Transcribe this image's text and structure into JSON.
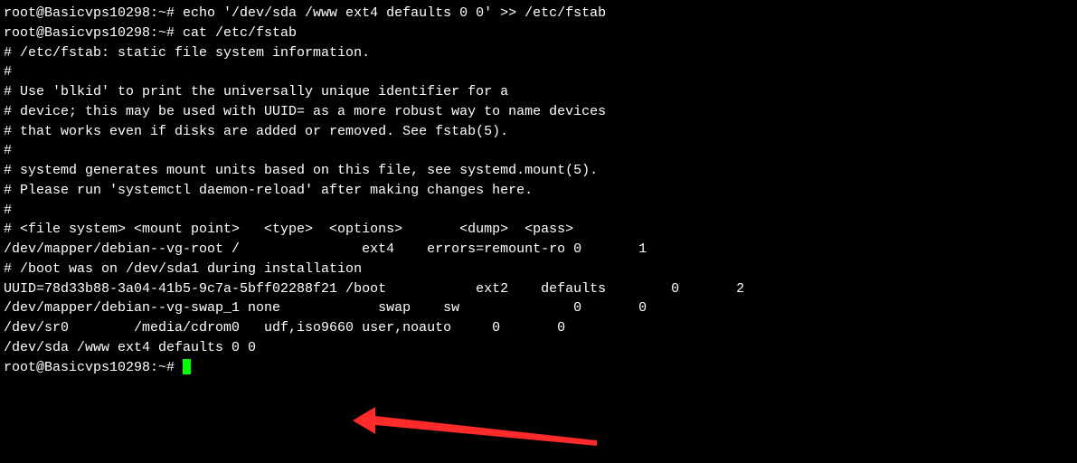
{
  "lines": {
    "l0": "root@Basicvps10298:~# echo '/dev/sda /www ext4 defaults 0 0' >> /etc/fstab",
    "l1": "root@Basicvps10298:~# cat /etc/fstab",
    "l2": "# /etc/fstab: static file system information.",
    "l3": "#",
    "l4": "# Use 'blkid' to print the universally unique identifier for a",
    "l5": "# device; this may be used with UUID= as a more robust way to name devices",
    "l6": "# that works even if disks are added or removed. See fstab(5).",
    "l7": "#",
    "l8": "# systemd generates mount units based on this file, see systemd.mount(5).",
    "l9": "# Please run 'systemctl daemon-reload' after making changes here.",
    "l10": "#",
    "l11": "# <file system> <mount point>   <type>  <options>       <dump>  <pass>",
    "l12": "/dev/mapper/debian--vg-root /               ext4    errors=remount-ro 0       1",
    "l13": "# /boot was on /dev/sda1 during installation",
    "l14": "UUID=78d33b88-3a04-41b5-9c7a-5bff02288f21 /boot           ext2    defaults        0       2",
    "l15": "/dev/mapper/debian--vg-swap_1 none            swap    sw              0       0",
    "l16": "/dev/sr0        /media/cdrom0   udf,iso9660 user,noauto     0       0",
    "l17": "/dev/sda /www ext4 defaults 0 0",
    "l18": "root@Basicvps10298:~# "
  },
  "arrow": {
    "color": "#ff2a2a"
  }
}
